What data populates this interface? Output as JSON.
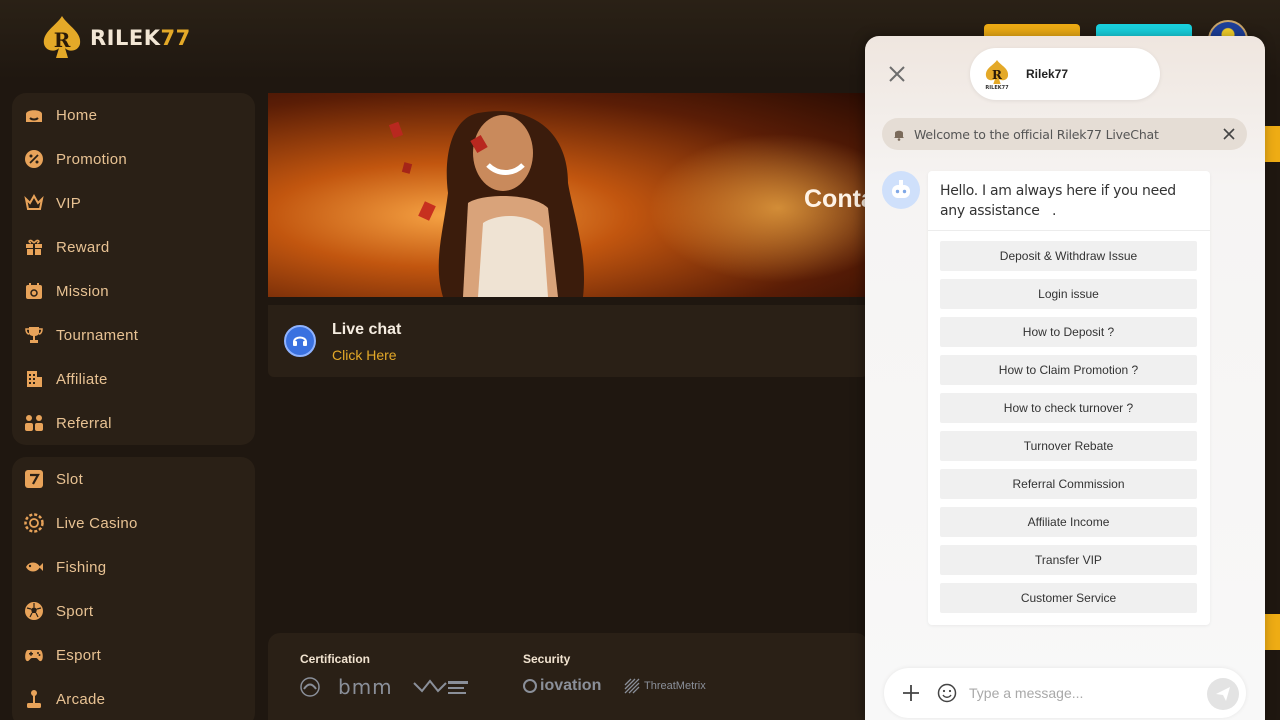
{
  "brand": {
    "name_text": "RILEK",
    "name_num": "77",
    "accent": "#e4a928"
  },
  "header": {
    "login_color": "#eeac14",
    "register_color": "#19d3e0"
  },
  "sidebar": {
    "primary": [
      {
        "label": "Home",
        "icon": "home-icon"
      },
      {
        "label": "Promotion",
        "icon": "percent-badge-icon"
      },
      {
        "label": "VIP",
        "icon": "crown-icon"
      },
      {
        "label": "Reward",
        "icon": "gift-icon"
      },
      {
        "label": "Mission",
        "icon": "calendar-icon"
      },
      {
        "label": "Tournament",
        "icon": "trophy-icon"
      },
      {
        "label": "Affiliate",
        "icon": "building-icon"
      },
      {
        "label": "Referral",
        "icon": "users-icon"
      }
    ],
    "games": [
      {
        "label": "Slot",
        "icon": "slot-seven-icon"
      },
      {
        "label": "Live Casino",
        "icon": "casino-chip-icon"
      },
      {
        "label": "Fishing",
        "icon": "fish-icon"
      },
      {
        "label": "Sport",
        "icon": "soccer-ball-icon"
      },
      {
        "label": "Esport",
        "icon": "gamepad-icon"
      },
      {
        "label": "Arcade",
        "icon": "joystick-icon"
      }
    ]
  },
  "banner": {
    "title": "Conta"
  },
  "contact": {
    "title": "Live chat",
    "link": "Click Here"
  },
  "footer": {
    "certification": "Certification",
    "security": "Security",
    "cert_logos": [
      "iTech Labs",
      "bmm",
      "TST GLOBAL"
    ],
    "security_logos": [
      "iovation",
      "ThreatMetrix"
    ]
  },
  "chat": {
    "agent_name": "Rilek77",
    "notice": "Welcome to the official Rilek77 LiveChat",
    "greeting": "Hello. I am always here if you need any assistance   .",
    "quick_replies": [
      "Deposit & Withdraw Issue",
      "Login issue",
      "How to Deposit ?",
      "How to Claim Promotion ?",
      "How to check turnover ?",
      "Turnover Rebate",
      "Referral Commission",
      "Affiliate Income",
      "Transfer VIP",
      "Customer Service"
    ],
    "input_placeholder": "Type a message..."
  }
}
